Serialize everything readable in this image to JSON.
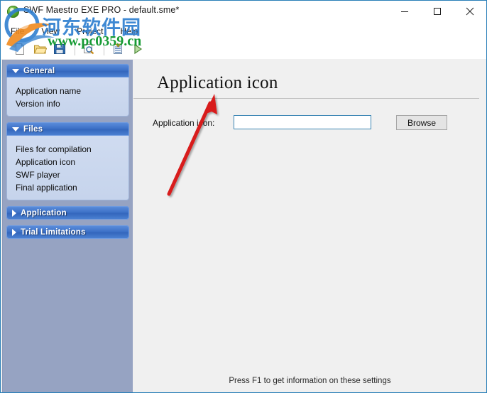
{
  "window": {
    "title": "SWF Maestro EXE PRO - default.sme*",
    "icon": "app-green-circle-icon",
    "controls": {
      "minimize": "minimize-icon",
      "maximize": "maximize-icon",
      "close": "close-icon"
    }
  },
  "menubar": {
    "items": [
      {
        "label": "File"
      },
      {
        "label": "View"
      },
      {
        "label": "Project"
      },
      {
        "label": "Help"
      }
    ]
  },
  "toolbar": {
    "buttons": [
      {
        "name": "new-file-icon",
        "tooltip": "New"
      },
      {
        "name": "open-folder-icon",
        "tooltip": "Open"
      },
      {
        "name": "save-floppy-icon",
        "tooltip": "Save"
      },
      {
        "name": "preview-magnifier-icon",
        "tooltip": "Preview"
      },
      {
        "name": "compile-list-icon",
        "tooltip": "Compile"
      },
      {
        "name": "run-play-icon",
        "tooltip": "Run"
      }
    ]
  },
  "sidebar": {
    "panels": [
      {
        "title": "General",
        "expanded": true,
        "items": [
          {
            "label": "Application name"
          },
          {
            "label": "Version info"
          }
        ]
      },
      {
        "title": "Files",
        "expanded": true,
        "items": [
          {
            "label": "Files for compilation"
          },
          {
            "label": "Application icon"
          },
          {
            "label": "SWF player"
          },
          {
            "label": "Final application"
          }
        ]
      },
      {
        "title": "Application",
        "expanded": false,
        "items": []
      },
      {
        "title": "Trial Limitations",
        "expanded": false,
        "items": []
      }
    ]
  },
  "main": {
    "page_title": "Application icon",
    "field": {
      "label": "Application icon:",
      "value": "",
      "placeholder": ""
    },
    "browse_label": "Browse",
    "status_text": "Press F1 to get information on these settings"
  },
  "watermark": {
    "chinese_text": "河东软件园",
    "url_text": "www.pc0359.cn",
    "chinese_color": "#2f7fd0",
    "url_color": "#169b34"
  },
  "annotation": {
    "type": "red-arrow",
    "color": "#d81a1a",
    "points_to": "page-title"
  },
  "colors": {
    "sidebar_background": "#96a3c2",
    "panel_header_blue": "#3e72c8",
    "panel_body_blue": "#cfdbf0",
    "content_background": "#f0f0f0",
    "window_border": "#2a7fb8",
    "input_border": "#3d86b4"
  }
}
